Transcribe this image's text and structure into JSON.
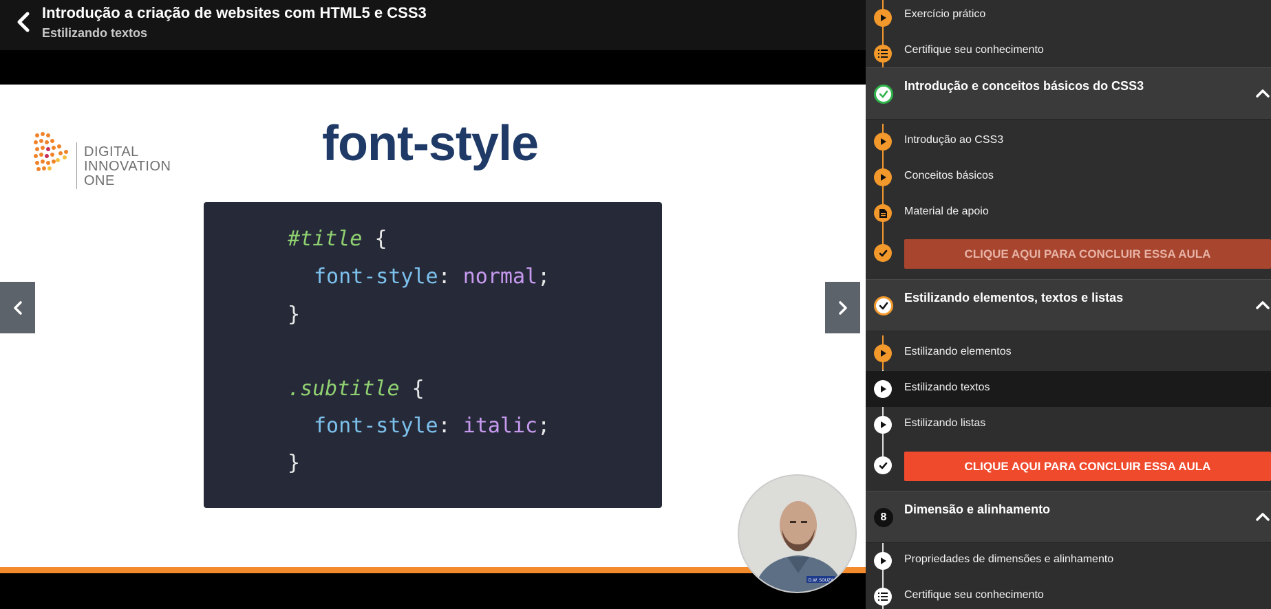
{
  "header": {
    "course_title": "Introdução a criação de websites com HTML5 e CSS3",
    "lesson_subtitle": "Estilizando textos"
  },
  "slide": {
    "logo_lines": [
      "DIGITAL",
      "INNOVATION",
      "ONE"
    ],
    "title": "font-style",
    "code": {
      "sel1": "#title",
      "brace_open": "{",
      "prop": "font-style",
      "colon": ":",
      "val1": "normal",
      "semicolon": ";",
      "brace_close": "}",
      "sel2": ".subtitle",
      "val2": "italic"
    },
    "webcam_badge": "D.W. SOUZA"
  },
  "sidebar": {
    "top_items": [
      {
        "label": "Exercício prático",
        "icon": "play-icon"
      },
      {
        "label": "Certifique seu conhecimento",
        "icon": "list-icon"
      }
    ],
    "sections": [
      {
        "title": "Introdução e conceitos básicos do CSS3",
        "status": "completed",
        "items": [
          {
            "label": "Introdução ao CSS3",
            "icon": "play-icon"
          },
          {
            "label": "Conceitos básicos",
            "icon": "play-icon"
          },
          {
            "label": "Material de apoio",
            "icon": "document-icon"
          }
        ],
        "conclude_label": "CLIQUE AQUI PARA CONCLUIR ESSA AULA"
      },
      {
        "title": "Estilizando elementos, textos e listas",
        "status": "in-progress",
        "items": [
          {
            "label": "Estilizando elementos",
            "icon": "play-icon"
          },
          {
            "label": "Estilizando textos",
            "icon": "play-icon",
            "active": true
          },
          {
            "label": "Estilizando listas",
            "icon": "play-icon"
          }
        ],
        "conclude_label": "CLIQUE AQUI PARA CONCLUIR ESSA AULA"
      },
      {
        "title": "Dimensão e alinhamento",
        "number": "8",
        "items": [
          {
            "label": "Propriedades de dimensões e alinhamento",
            "icon": "play-icon"
          },
          {
            "label": "Certifique seu conhecimento",
            "icon": "list-icon"
          }
        ]
      }
    ]
  },
  "colors": {
    "accent_orange": "#f3992c",
    "conclude_active": "#f04a2d",
    "slide_title": "#1f3a67"
  }
}
